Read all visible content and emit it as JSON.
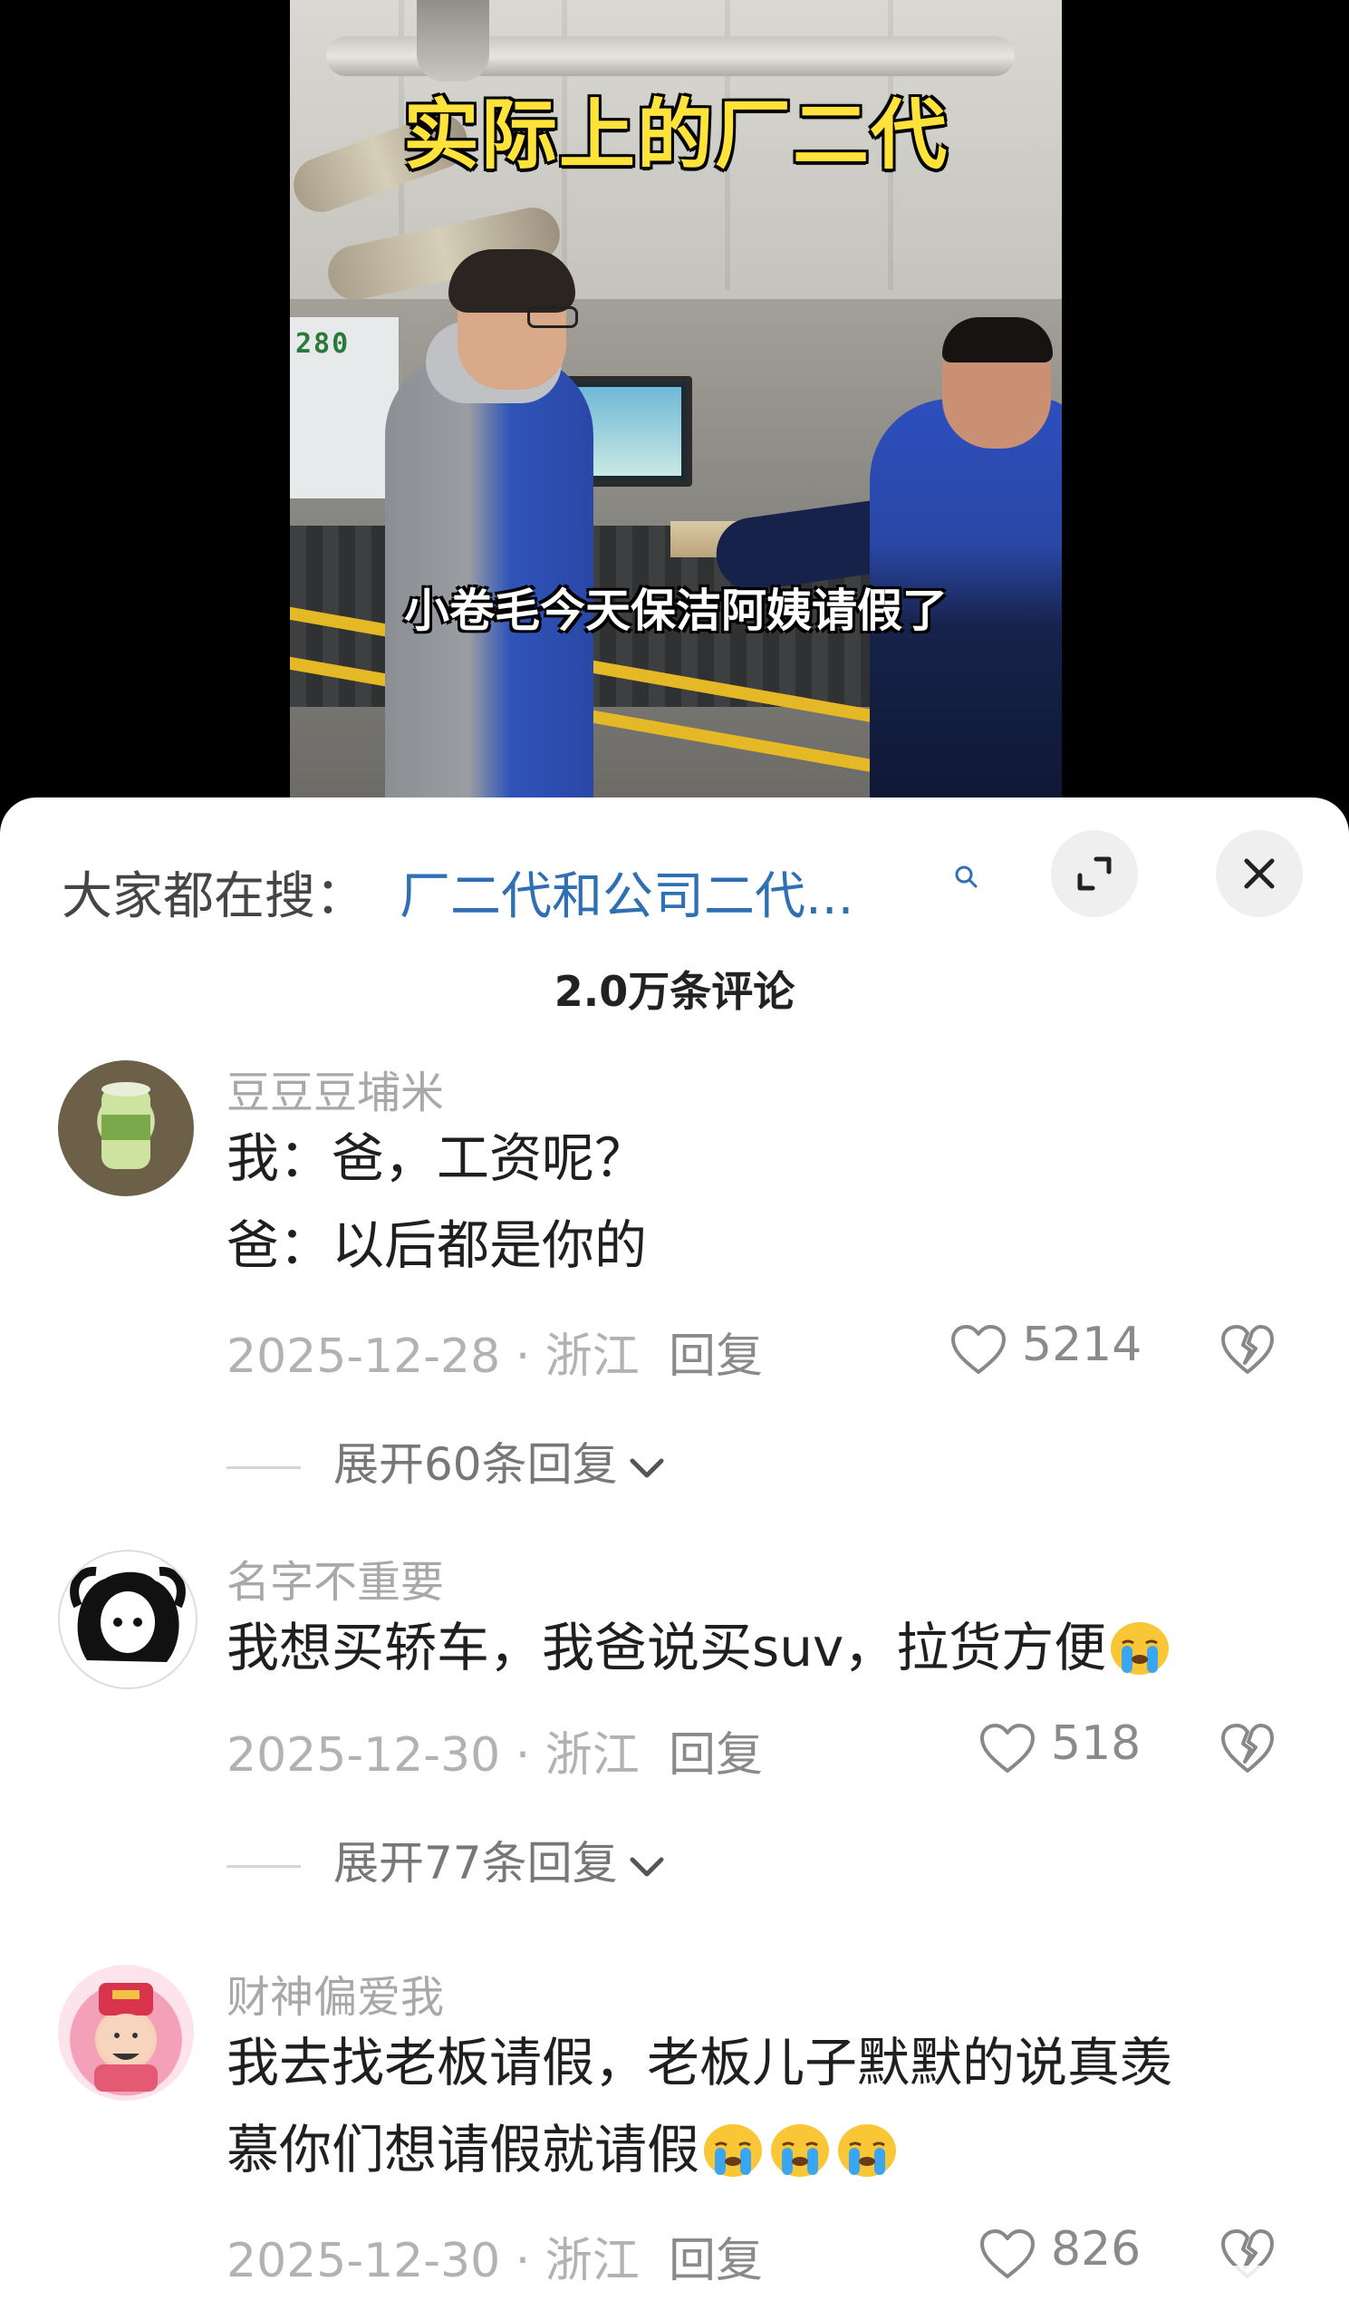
{
  "video": {
    "title_caption": "实际上的厂二代",
    "subtitle_caption": "小卷毛今天保洁阿姨请假了",
    "machine_label": "280"
  },
  "search": {
    "prefix": "大家都在搜：",
    "query": "厂二代和公司二代..."
  },
  "comments_header": {
    "count_label": "2.0万条评论"
  },
  "comments": [
    {
      "username": "豆豆豆埔米",
      "lines": [
        "我：爸，工资呢？",
        "爸：以后都是你的"
      ],
      "date_location": "2025-12-28 · 浙江",
      "reply_label": "回复",
      "likes": "5214",
      "expand_label": "展开60条回复"
    },
    {
      "username": "名字不重要",
      "lines": [
        "我想买轿车，我爸说买suv，拉货方便"
      ],
      "date_location": "2025-12-30 · 浙江",
      "reply_label": "回复",
      "likes": "518",
      "expand_label": "展开77条回复"
    },
    {
      "username": "财神偏爱我",
      "lines": [
        "我去找老板请假，老板儿子默默的说真羡",
        "慕你们想请假就请假"
      ],
      "date_location": "2025-12-30 · 浙江",
      "reply_label": "回复",
      "likes": "826"
    }
  ],
  "colors": {
    "link_blue": "#2f6fb4",
    "caption_yellow": "#ffe23a",
    "muted_gray": "#b2b2b2"
  }
}
